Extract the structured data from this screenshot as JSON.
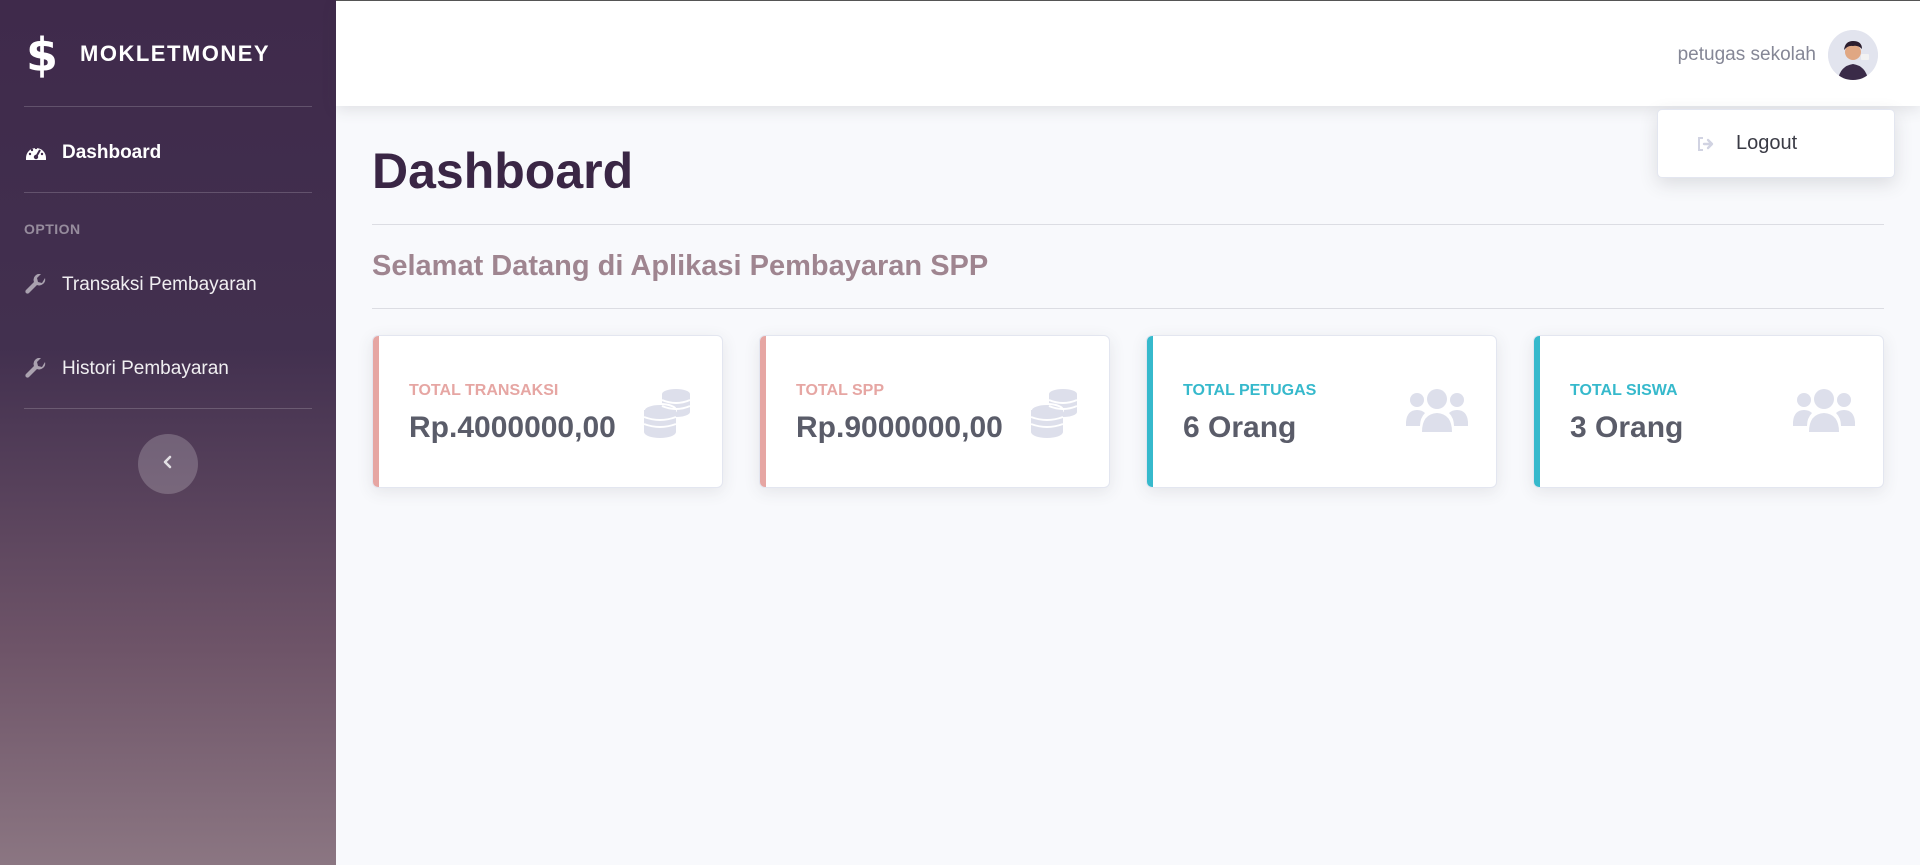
{
  "app": {
    "name": "MOKLETMONEY"
  },
  "sidebar": {
    "dashboard_label": "Dashboard",
    "heading": "OPTION",
    "items": [
      {
        "label": "Transaksi Pembayaran",
        "icon": "wrench-icon"
      },
      {
        "label": "Histori Pembayaran",
        "icon": "wrench-icon"
      }
    ]
  },
  "topbar": {
    "user_name": "petugas sekolah"
  },
  "dropdown": {
    "logout_label": "Logout"
  },
  "main": {
    "title": "Dashboard",
    "welcome": "Selamat Datang di Aplikasi Pembayaran SPP",
    "cards": [
      {
        "label": "TOTAL TRANSAKSI",
        "value": "Rp.4000000,00",
        "color": "#e6a6a3",
        "icon": "coins-icon"
      },
      {
        "label": "TOTAL SPP",
        "value": "Rp.9000000,00",
        "color": "#e6a6a3",
        "icon": "coins-icon"
      },
      {
        "label": "TOTAL PETUGAS",
        "value": "6 Orang",
        "color": "#36b9cc",
        "icon": "users-icon"
      },
      {
        "label": "TOTAL SISWA",
        "value": "3 Orang",
        "color": "#36b9cc",
        "icon": "users-icon"
      }
    ]
  }
}
